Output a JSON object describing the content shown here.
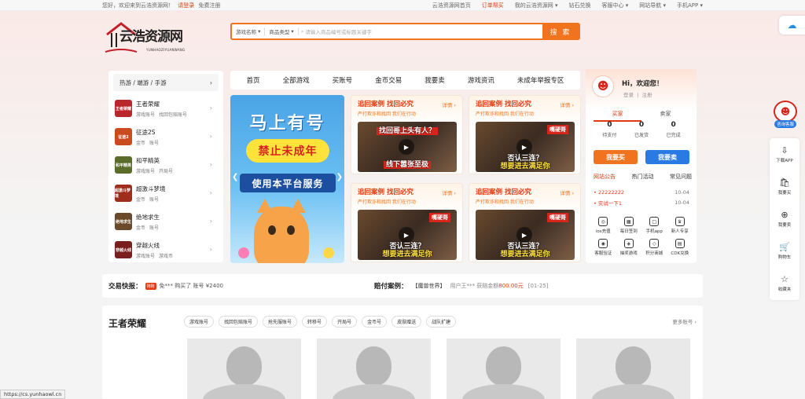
{
  "topbar": {
    "welcome": "您好，欢迎来到云浩资源网！",
    "login": "请登录",
    "register": "免费注册",
    "links": [
      "云浩资源网首页",
      "订单帮买",
      "我的云浩资源网 ▾",
      "钻石兑换",
      "客服中心 ▾",
      "网站导航 ▾",
      "手机APP ▾"
    ]
  },
  "logo": {
    "text": "云浩资源网",
    "sub": "YUNHAOZIYUANWANG"
  },
  "search": {
    "game_select": "游戏名称",
    "type_select": "商品类型",
    "placeholder": "请输入商品编号或标题关键字",
    "button": "搜 索"
  },
  "sidebar": {
    "header": "热游 / 端游 / 手游",
    "items": [
      {
        "name": "王者荣耀",
        "tags": [
          "游戏账号",
          "找回包赔账号"
        ],
        "color": "#b8282a",
        "icon_text": "王者荣耀"
      },
      {
        "name": "征途2S",
        "tags": [
          "金币",
          "账号"
        ],
        "color": "#c94b1e",
        "icon_text": "征途2"
      },
      {
        "name": "和平精英",
        "tags": [
          "游戏账号",
          "开局号"
        ],
        "color": "#5a6b2a",
        "icon_text": "和平精英"
      },
      {
        "name": "超激斗梦境",
        "tags": [
          "金币",
          "账号"
        ],
        "color": "#9e2d1c",
        "icon_text": "超激斗梦境"
      },
      {
        "name": "绝地求生",
        "tags": [
          "金币",
          "账号"
        ],
        "color": "#6a4a2a",
        "icon_text": "绝地求生"
      },
      {
        "name": "穿越火线",
        "tags": [
          "游戏账号",
          "游戏币"
        ],
        "color": "#7a1e1e",
        "icon_text": "穿越火线"
      }
    ]
  },
  "nav": [
    "首页",
    "全部游戏",
    "买账号",
    "金币交易",
    "我要卖",
    "游戏资讯",
    "未成年举报专区"
  ],
  "banner": {
    "line1": "马上有号",
    "line2": "禁止未成年",
    "line3": "使用本平台服务"
  },
  "cases": [
    {
      "title": "追回案例 找回必究",
      "more": "详情 ›",
      "sub": "严打欺诈和找回  我们在行动",
      "cap1": "找回哥上头有人？",
      "cap2": "线下嚣张至极",
      "tag": ""
    },
    {
      "title": "追回案例 找回必究",
      "more": "详情 ›",
      "sub": "严打欺诈和找回  我们在行动",
      "cap1": "",
      "cap2": "想要进去满足你",
      "tag": "嘴硬哥",
      "mid": "否认三连？"
    },
    {
      "title": "追回案例 找回必究",
      "more": "详情 ›",
      "sub": "严打欺诈和找回  我们在行动",
      "cap1": "",
      "cap2": "想要进去满足你",
      "tag": "嘴硬哥",
      "mid": "否认三连？"
    },
    {
      "title": "追回案例 找回必究",
      "more": "详情 ›",
      "sub": "严打欺诈和找回  我们在行动",
      "cap1": "",
      "cap2": "想要进去满足你",
      "tag": "嘴硬哥",
      "mid": "否认三连？"
    }
  ],
  "user": {
    "greeting": "Hi，欢迎您！",
    "login": "登录",
    "register": "注册",
    "tabs": [
      "买家",
      "卖家"
    ],
    "stats": [
      {
        "n": "0",
        "l": "待支付"
      },
      {
        "n": "0",
        "l": "已发货"
      },
      {
        "n": "0",
        "l": "已完成"
      }
    ],
    "buy_btn": "我要买",
    "sell_btn": "我要卖",
    "notice_tabs": [
      "网站公告",
      "热门活动",
      "常见问题"
    ],
    "notices": [
      {
        "t": "22222222",
        "d": "10-04"
      },
      {
        "t": "实试一下1",
        "d": "10-04"
      }
    ],
    "grid": [
      "ios充值",
      "每日签到",
      "手机app",
      "新人专享",
      "客服验证",
      "抽奖游戏",
      "积分商城",
      "CDK兑换"
    ],
    "grid_icons": [
      "◎",
      "▦",
      "□",
      "♛",
      "◉",
      "◈",
      "◇",
      "▤"
    ]
  },
  "ticker": {
    "label": "交易快报：",
    "badge": "刚刚",
    "text": "免*** 购买了 账号 ¥2400",
    "compensation_label": "赔付案例：",
    "comp_game": "【魔兽世界】",
    "comp_user": "用户王*** 获赔金额",
    "comp_amount": "800.00元",
    "comp_date": "[01-25]"
  },
  "section": {
    "title": "王者荣耀",
    "chips": [
      "游戏账号",
      "找回包赔账号",
      "抢先服账号",
      "转移号",
      "开局号",
      "金币号",
      "皮肤赠送",
      "战队扩建"
    ],
    "more": "更多账号 ›"
  },
  "rail": {
    "items": [
      {
        "icon": "⇩",
        "label": "下载APP"
      },
      {
        "icon": "🛍",
        "label": "我要买"
      },
      {
        "icon": "⊕",
        "label": "我要卖"
      },
      {
        "icon": "🛒",
        "label": "购物车"
      },
      {
        "icon": "☆",
        "label": "收藏夹"
      }
    ]
  },
  "mascot_label": "咨询客服",
  "status_url": "https://cs.yunhaowl.cn",
  "colors": {
    "accent": "#f0731f",
    "red": "#e4380f",
    "blue": "#2a7ae4"
  }
}
